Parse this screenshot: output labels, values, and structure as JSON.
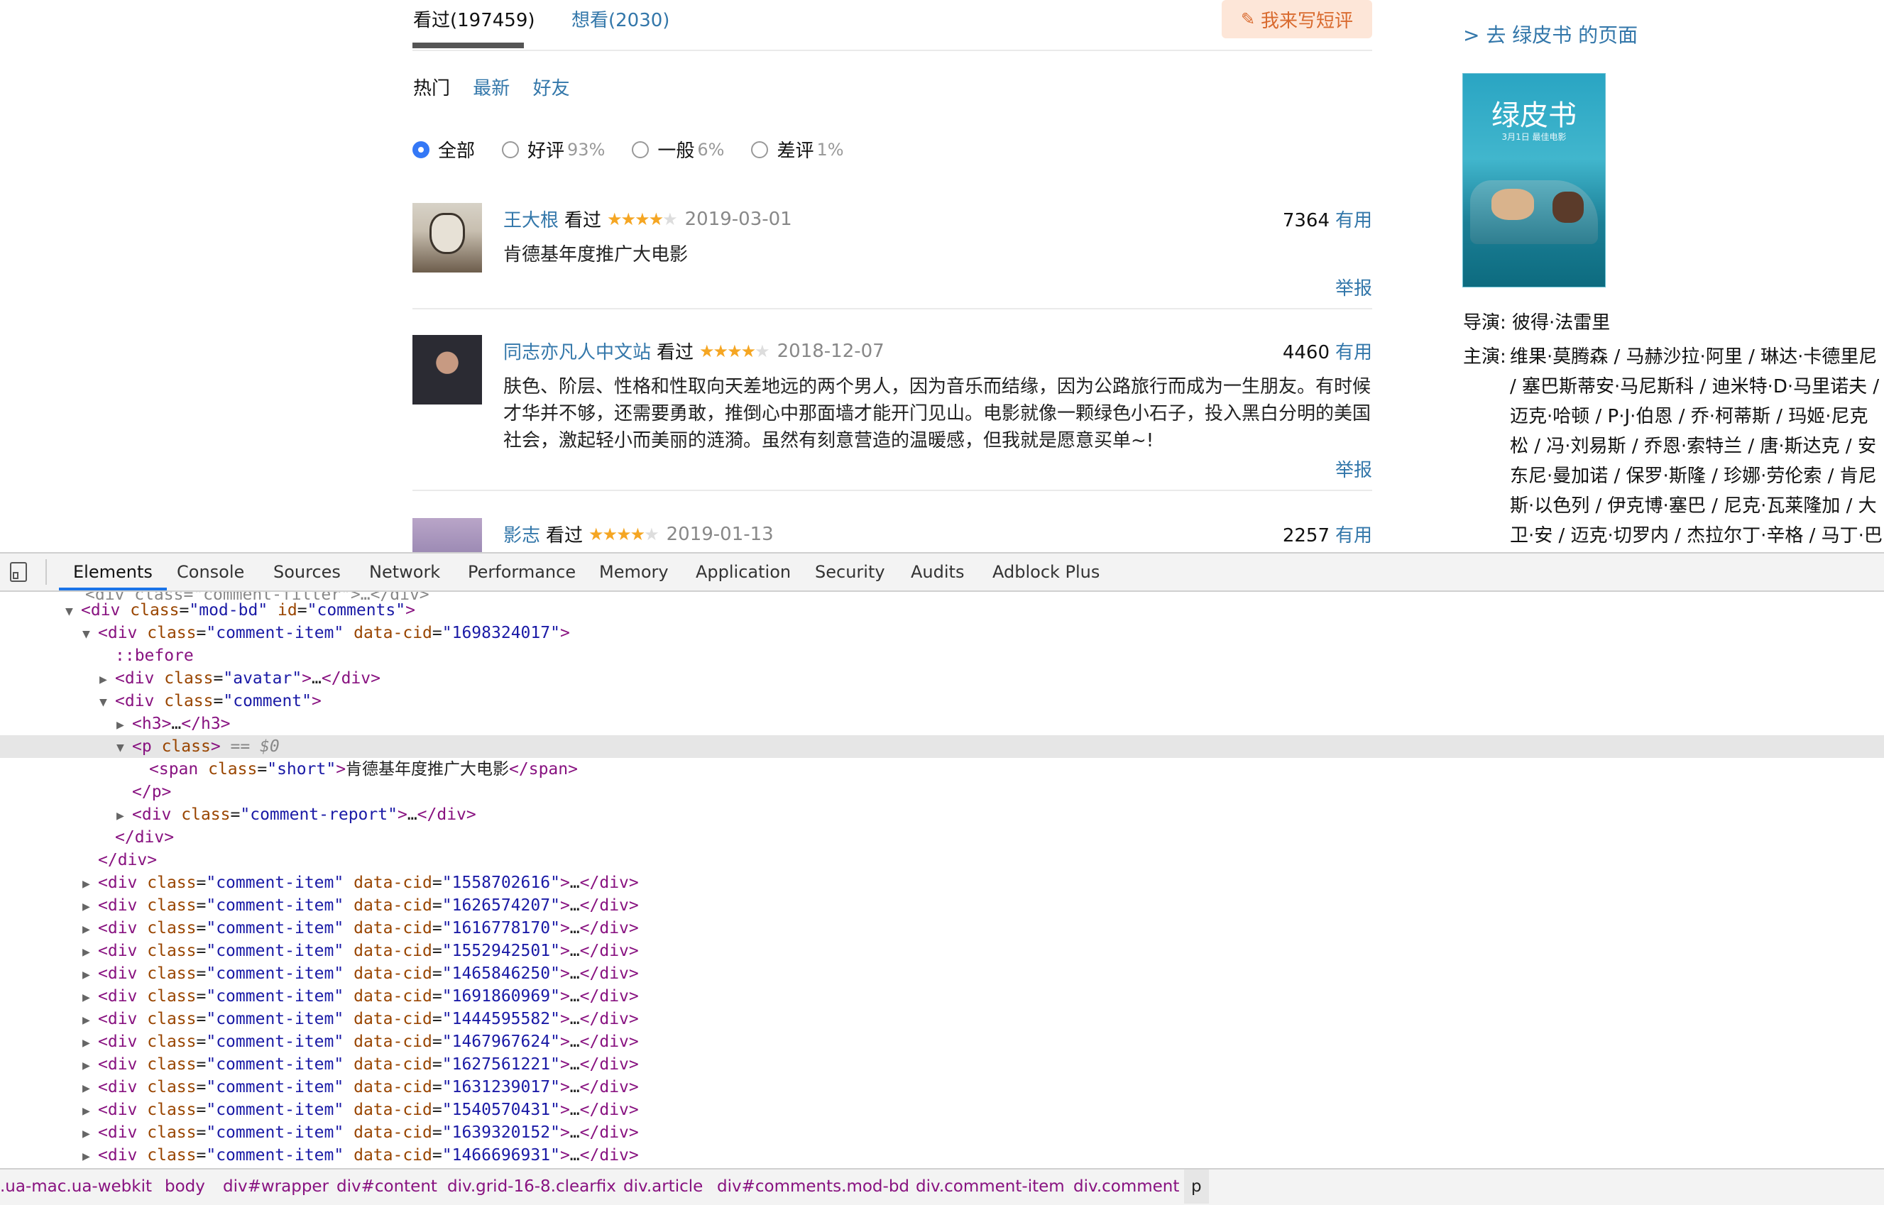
{
  "tabs": {
    "watched": "看过(197459)",
    "want": "想看(2030)",
    "write": "我来写短评"
  },
  "sort": {
    "hot": "热门",
    "latest": "最新",
    "friends": "好友"
  },
  "filters": [
    {
      "label": "全部",
      "pct": ""
    },
    {
      "label": "好评",
      "pct": "93%"
    },
    {
      "label": "一般",
      "pct": "6%"
    },
    {
      "label": "差评",
      "pct": "1%"
    }
  ],
  "comments": [
    {
      "user": "王大根",
      "status": "看过",
      "rating": 4,
      "date": "2019-03-01",
      "votes": "7364",
      "useful": "有用",
      "text": "肯德基年度推广大电影",
      "report": "举报"
    },
    {
      "user": "同志亦凡人中文站",
      "status": "看过",
      "rating": 4,
      "date": "2018-12-07",
      "votes": "4460",
      "useful": "有用",
      "text": "肤色、阶层、性格和性取向天差地远的两个男人，因为音乐而结缘，因为公路旅行而成为一生朋友。有时候才华并不够，还需要勇敢，推倒心中那面墙才能开门见山。电影就像一颗绿色小石子，投入黑白分明的美国社会，激起轻小而美丽的涟漪。虽然有刻意营造的温暖感，但我就是愿意买单~!",
      "report": "举报"
    },
    {
      "user": "影志",
      "status": "看过",
      "rating": 4,
      "date": "2019-01-13",
      "votes": "2257",
      "useful": "有用"
    }
  ],
  "aside": {
    "go_link": "> 去 绿皮书 的页面",
    "poster_title": "绿皮书",
    "poster_sub": "3月1日 最佳电影",
    "director_label": "导演:",
    "director": "彼得·法雷里",
    "cast_label": "主演:",
    "cast": "维果·莫腾森 / 马赫沙拉·阿里 / 琳达·卡德里尼 / 塞巴斯蒂安·马尼斯科 / 迪米特·D·马里诺夫 / 迈克·哈顿 / P·J·伯恩 / 乔·柯蒂斯 / 玛姬·尼克松 / 冯·刘易斯 / 乔恩·索特兰 / 唐·斯达克 / 安东尼·曼加诺 / 保罗·斯隆 / 珍娜·劳伦索 / 肯尼斯·以色列 / 伊克博·塞巴 / 尼克·瓦莱隆加 / 大卫·安 / 迈克·切罗内 / 杰拉尔丁·辛格 / 马丁·巴特斯·布拉"
  },
  "devtools": {
    "tabs": [
      "Elements",
      "Console",
      "Sources",
      "Network",
      "Performance",
      "Memory",
      "Application",
      "Security",
      "Audits",
      "Adblock Plus"
    ],
    "top_partial": "<div class=\"comment-filter\">…</div>",
    "mod_bd": {
      "tag": "div",
      "class": "mod-bd",
      "id": "comments"
    },
    "first_item": {
      "class": "comment-item",
      "cid": "1698324017"
    },
    "before": "::before",
    "avatar_class": "avatar",
    "comment_class": "comment",
    "h3": "h3",
    "p_class_text": "class",
    "p_marker": "== $0",
    "span_class": "short",
    "span_text": "肯德基年度推广大电影",
    "report_class": "comment-report",
    "item_cids": [
      "1558702616",
      "1626574207",
      "1616778170",
      "1552942501",
      "1465846250",
      "1691860969",
      "1444595582",
      "1467967624",
      "1627561221",
      "1631239017",
      "1540570431",
      "1639320152",
      "1466696931"
    ],
    "breadcrumbs": [
      ".ua-mac.ua-webkit",
      "body",
      "div#wrapper",
      "div#content",
      "div.grid-16-8.clearfix",
      "div.article",
      "div#comments.mod-bd",
      "div.comment-item",
      "div.comment",
      "p"
    ]
  },
  "colors": {
    "link": "#3377aa",
    "star": "#f5a623",
    "accent": "#1a73e8",
    "write_bg": "#fde6d8"
  }
}
